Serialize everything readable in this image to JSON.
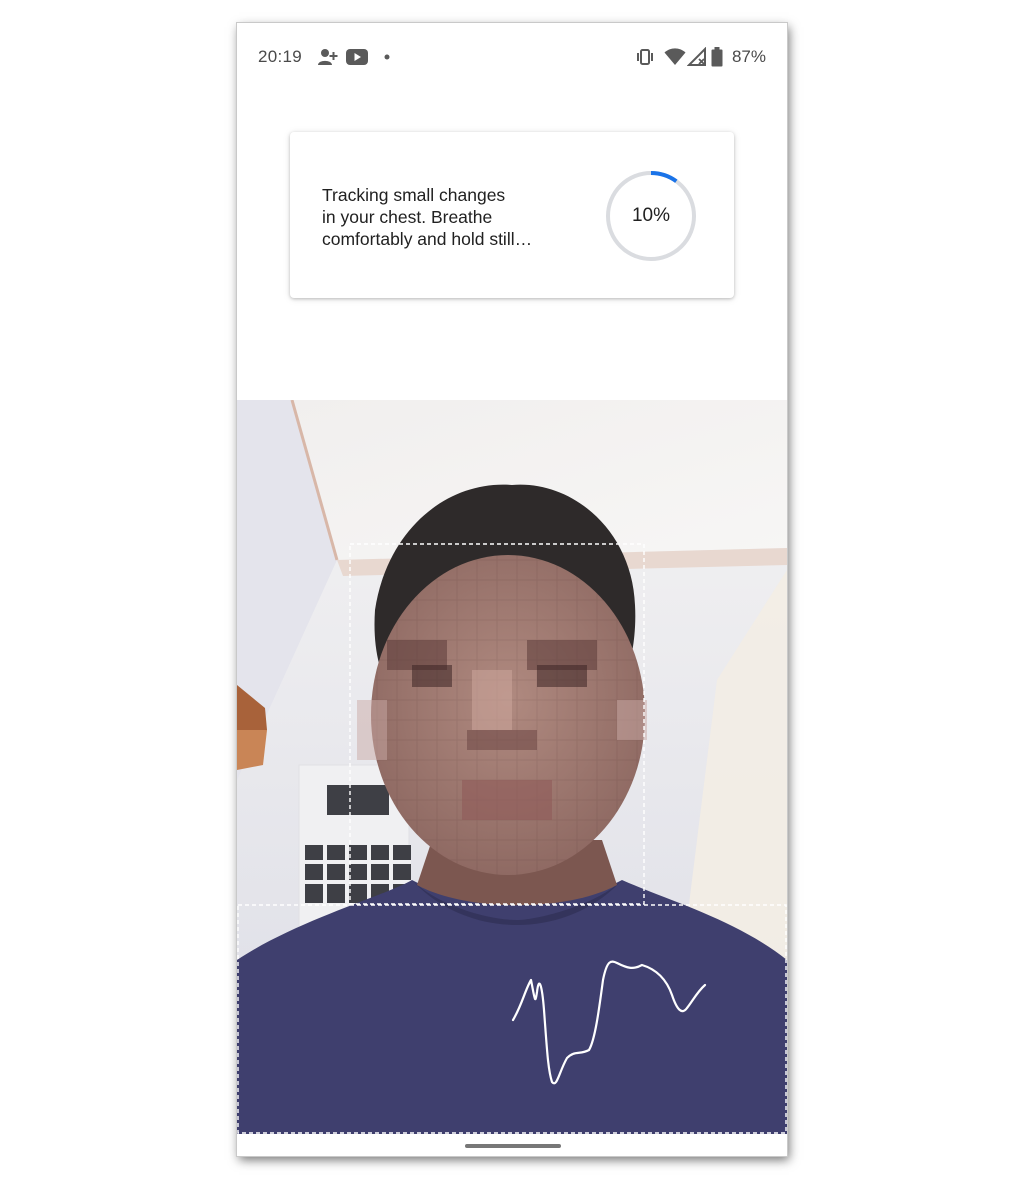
{
  "status_bar": {
    "time": "20:19",
    "battery_percent": "87%",
    "left_icons": [
      "person-add-icon",
      "youtube-icon",
      "notification-dot-icon"
    ],
    "right_icons": [
      "vibrate-icon",
      "wifi-icon",
      "cellular-no-signal-icon",
      "battery-icon"
    ]
  },
  "card": {
    "message_lines": [
      "Tracking small changes",
      "in your chest. Breathe",
      "comfortably and hold still…"
    ],
    "progress_label": "10%",
    "progress_value": 0.1,
    "progress_color": "#1a73e8",
    "track_color": "#dadce0"
  },
  "camera": {
    "face_box": "dashed-face-tracking-box",
    "chest_box": "dashed-chest-tracking-box",
    "waveform": "breathing-waveform",
    "face_blurred": true
  },
  "nav": {
    "handle": "gesture-nav-handle"
  }
}
